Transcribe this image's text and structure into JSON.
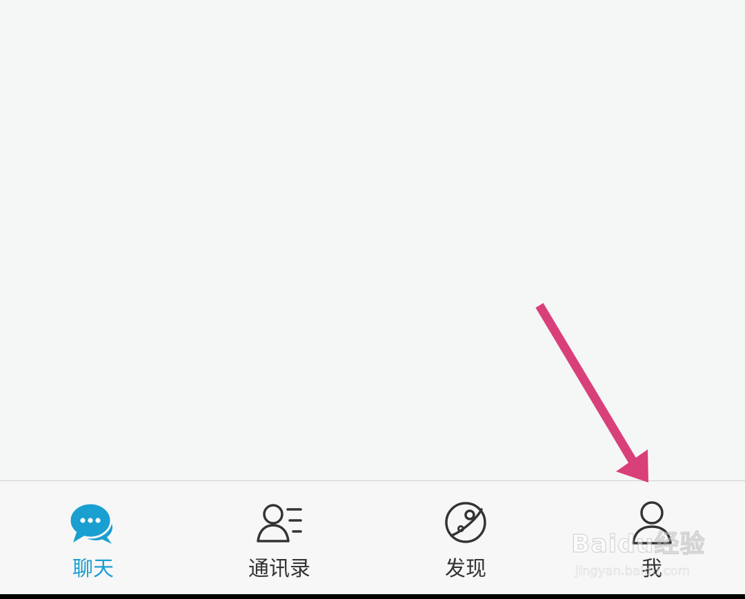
{
  "tab_bar": {
    "tabs": [
      {
        "label": "聊天",
        "icon": "chat-bubbles-icon",
        "active": true
      },
      {
        "label": "通讯录",
        "icon": "contacts-icon",
        "active": false
      },
      {
        "label": "发现",
        "icon": "planet-icon",
        "active": false
      },
      {
        "label": "我",
        "icon": "person-icon",
        "active": false
      }
    ]
  },
  "watermark": {
    "main": "Baidu经验",
    "sub": "jingyan.baidu.com"
  },
  "colors": {
    "active": "#1a9fd1",
    "inactive": "#333333",
    "background": "#f5f6f6",
    "arrow": "#d9407a"
  }
}
